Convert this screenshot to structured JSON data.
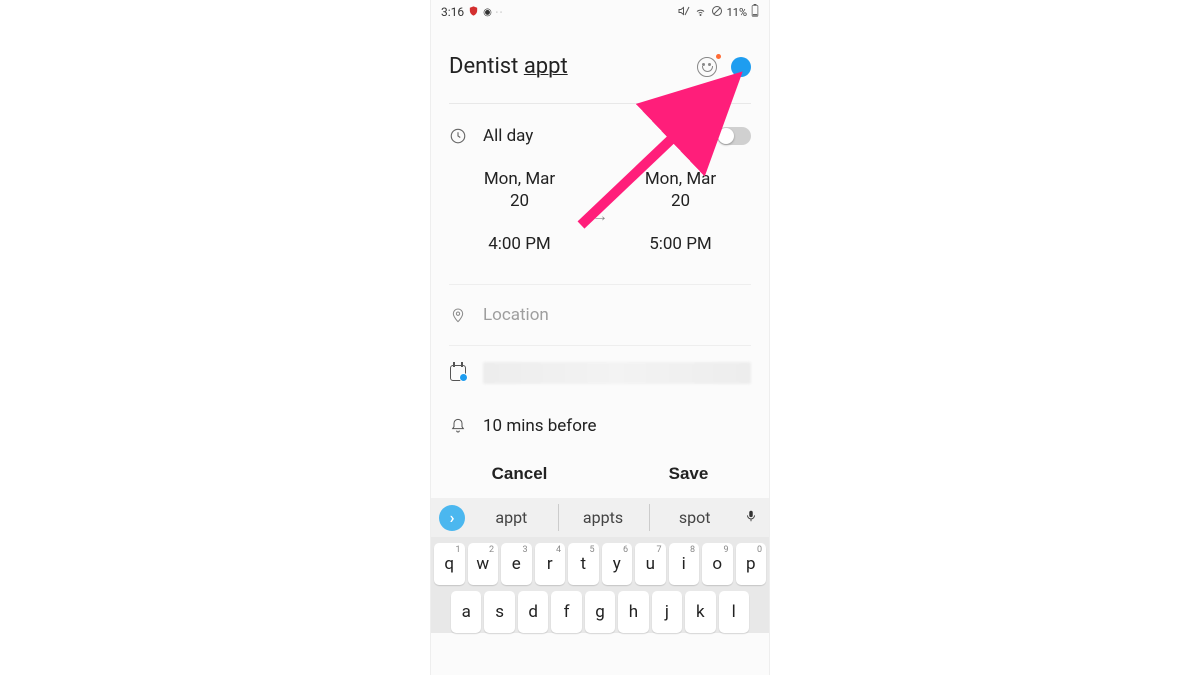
{
  "status_bar": {
    "time": "3:16",
    "battery": "11%"
  },
  "event": {
    "title_prefix": "Dentist ",
    "title_suffix": "appt",
    "color_hex": "#1e9df0",
    "all_day_label": "All day",
    "all_day_enabled": false,
    "start_date_line1": "Mon, Mar",
    "start_date_line2": "20",
    "end_date_line1": "Mon, Mar",
    "end_date_line2": "20",
    "start_time": "4:00 PM",
    "end_time": "5:00 PM",
    "location_placeholder": "Location",
    "reminder_label": "10 mins before"
  },
  "actions": {
    "cancel": "Cancel",
    "save": "Save"
  },
  "suggestions": {
    "items": [
      "appt",
      "appts",
      "spot"
    ]
  },
  "keyboard": {
    "row1": [
      {
        "k": "q",
        "n": "1"
      },
      {
        "k": "w",
        "n": "2"
      },
      {
        "k": "e",
        "n": "3"
      },
      {
        "k": "r",
        "n": "4"
      },
      {
        "k": "t",
        "n": "5"
      },
      {
        "k": "y",
        "n": "6"
      },
      {
        "k": "u",
        "n": "7"
      },
      {
        "k": "i",
        "n": "8"
      },
      {
        "k": "o",
        "n": "9"
      },
      {
        "k": "p",
        "n": "0"
      }
    ],
    "row2": [
      "a",
      "s",
      "d",
      "f",
      "g",
      "h",
      "j",
      "k",
      "l"
    ]
  }
}
